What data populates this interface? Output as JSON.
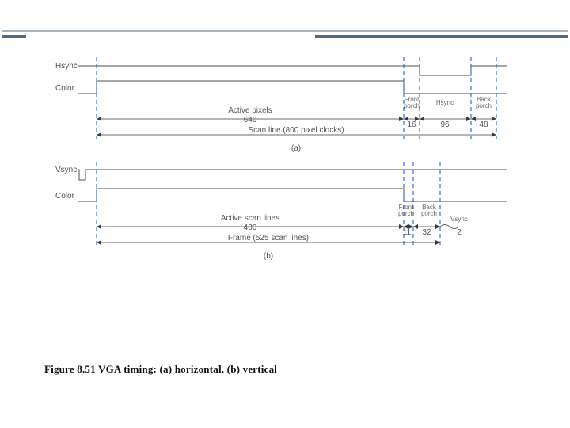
{
  "caption": "Figure 8.51 VGA timing: (a) horizontal, (b) vertical",
  "a": {
    "hsync_label": "Hsync",
    "color_label": "Color",
    "active_label": "Active pixels",
    "active_value": "640",
    "scan_label": "Scan line (800 pixel clocks)",
    "fp_label_1": "Front",
    "fp_label_2": "porch",
    "fp_value": "16",
    "hsync_w_label": "Hsync",
    "hsync_w_value": "96",
    "bp_label_1": "Back",
    "bp_label_2": "porch",
    "bp_value": "48",
    "panel": "(a)"
  },
  "b": {
    "vsync_label": "Vsync",
    "color_label": "Color",
    "active_label": "Active scan lines",
    "active_value": "480",
    "frame_label": "Frame (525 scan lines)",
    "fp_label_1": "Front",
    "fp_label_2": "porch",
    "fp_value": "11",
    "bp_label_1": "Back",
    "bp_label_2": "porch",
    "bp_value": "32",
    "vsync_w_label": "Vsync",
    "vsync_w_value": "2",
    "panel": "(b)"
  },
  "chart_data": [
    {
      "type": "timing-diagram",
      "title": "VGA horizontal timing",
      "unit": "pixel clocks",
      "total": 800,
      "segments": [
        {
          "name": "Active pixels",
          "length": 640
        },
        {
          "name": "Front porch",
          "length": 16
        },
        {
          "name": "Hsync",
          "length": 96
        },
        {
          "name": "Back porch",
          "length": 48
        }
      ],
      "signals": [
        "Hsync",
        "Color"
      ]
    },
    {
      "type": "timing-diagram",
      "title": "VGA vertical timing",
      "unit": "scan lines",
      "total": 525,
      "segments": [
        {
          "name": "Active scan lines",
          "length": 480
        },
        {
          "name": "Front porch",
          "length": 11
        },
        {
          "name": "Vsync",
          "length": 2
        },
        {
          "name": "Back porch",
          "length": 32
        }
      ],
      "signals": [
        "Vsync",
        "Color"
      ]
    }
  ]
}
